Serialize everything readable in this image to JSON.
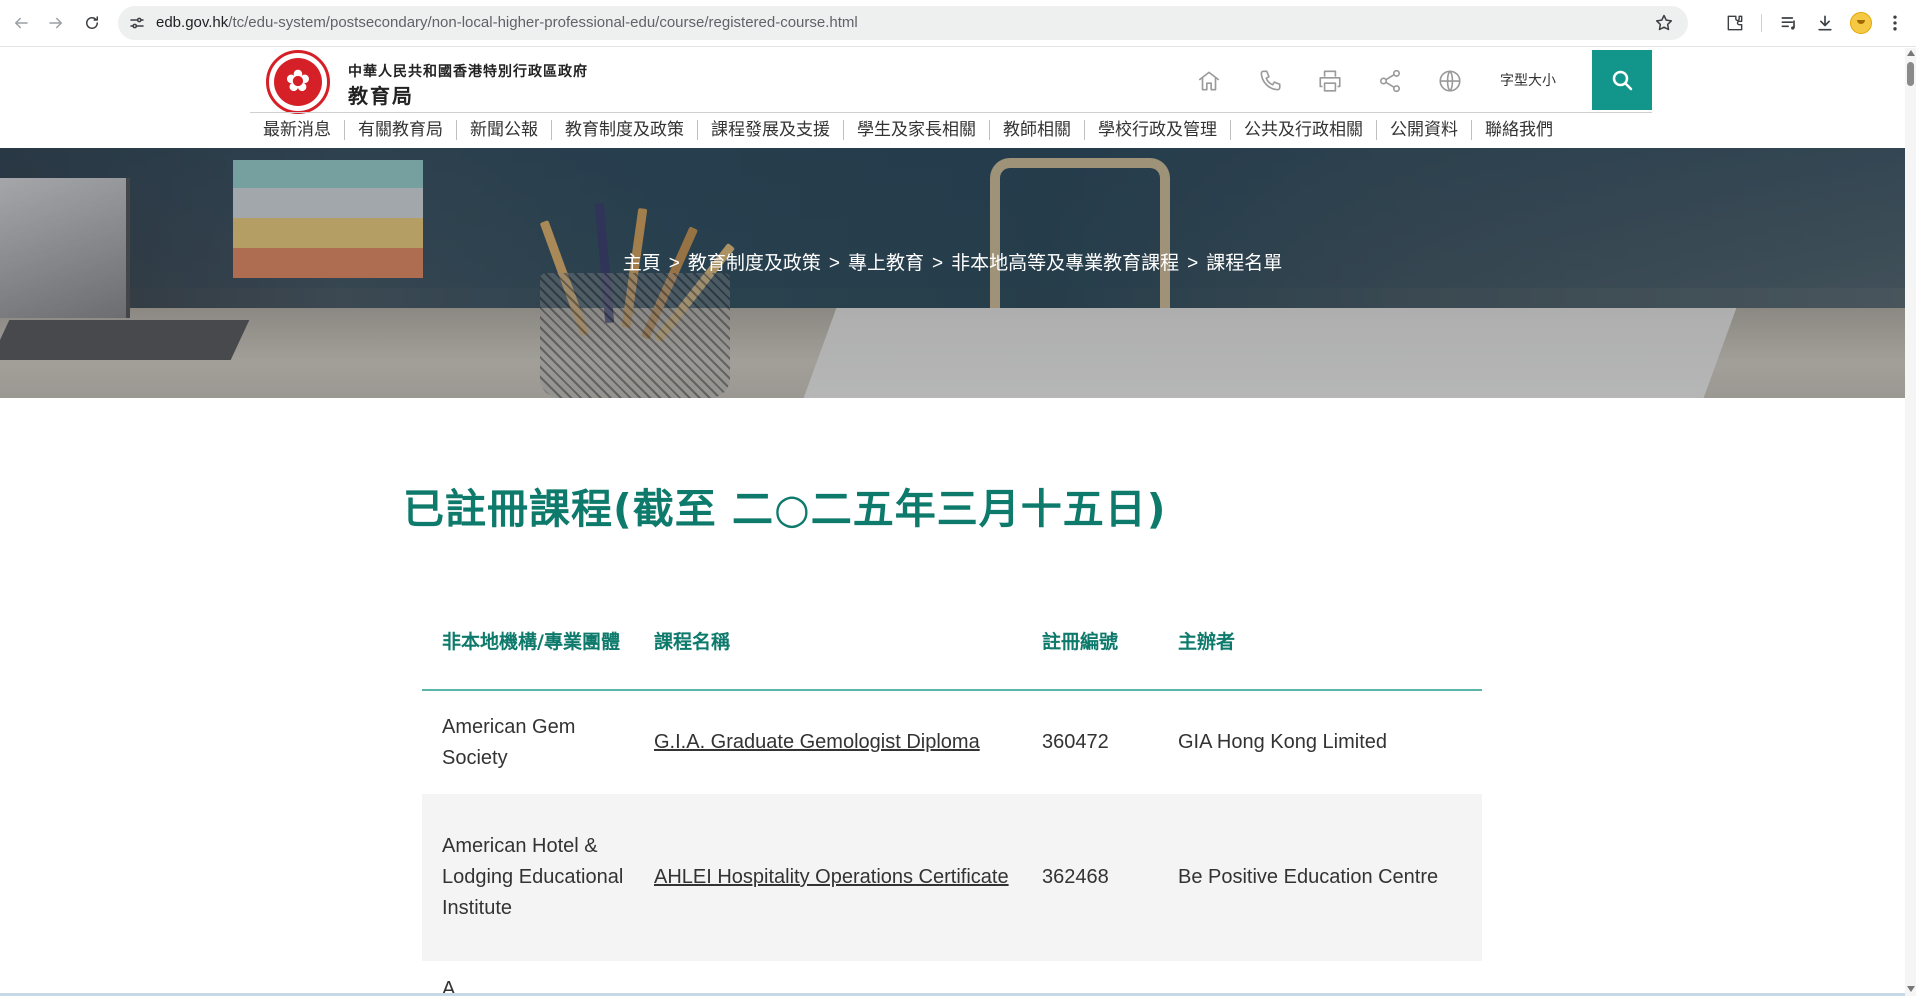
{
  "browser": {
    "url_domain": "edb.gov.hk",
    "url_path": "/tc/edu-system/postsecondary/non-local-higher-professional-edu/course/registered-course.html",
    "icons": [
      "back-icon",
      "forward-icon",
      "reload-icon",
      "site-info-icon",
      "bookmark-star-icon",
      "extensions-icon",
      "media-icon",
      "download-icon",
      "profile-avatar-icon",
      "menu-icon"
    ]
  },
  "header": {
    "gov_name": "中華人民共和國香港特別行政區政府",
    "bureau_name": "教育局",
    "logo_icon": "bauhinia-emblem",
    "font_size_label": "字型大小",
    "tools": [
      "home-icon",
      "phone-icon",
      "print-icon",
      "share-icon",
      "globe-icon",
      "search-icon"
    ],
    "accent_color": "#12958a"
  },
  "nav": {
    "items": [
      {
        "label": "最新消息"
      },
      {
        "label": "有關教育局"
      },
      {
        "label": "新聞公報"
      },
      {
        "label": "教育制度及政策"
      },
      {
        "label": "課程發展及支援"
      },
      {
        "label": "學生及家長相關"
      },
      {
        "label": "教師相關"
      },
      {
        "label": "學校行政及管理"
      },
      {
        "label": "公共及行政相關"
      },
      {
        "label": "公開資料"
      },
      {
        "label": "聯絡我們"
      }
    ]
  },
  "breadcrumb": {
    "items": [
      {
        "label": "主頁"
      },
      {
        "label": "教育制度及政策"
      },
      {
        "label": "專上教育"
      },
      {
        "label": "非本地高等及專業教育課程"
      },
      {
        "label": "課程名單"
      }
    ],
    "separator": ">"
  },
  "page": {
    "title": "已註冊課程(截至 二○二五年三月十五日)",
    "title_color": "#0e7a6c"
  },
  "table": {
    "headers": {
      "institution": "非本地機構/專業團體",
      "course": "課程名稱",
      "reg_no": "註冊編號",
      "operator": "主辦者"
    },
    "rows": [
      {
        "institution": "American Gem Society",
        "course": "G.I.A. Graduate Gemologist Diploma",
        "reg_no": "360472",
        "operator": "GIA Hong Kong Limited"
      },
      {
        "institution": "American Hotel & Lodging Educational Institute",
        "course": "AHLEI Hospitality Operations Certificate",
        "reg_no": "362468",
        "operator": "Be Positive Education Centre"
      }
    ],
    "next_row_peek": "A"
  }
}
